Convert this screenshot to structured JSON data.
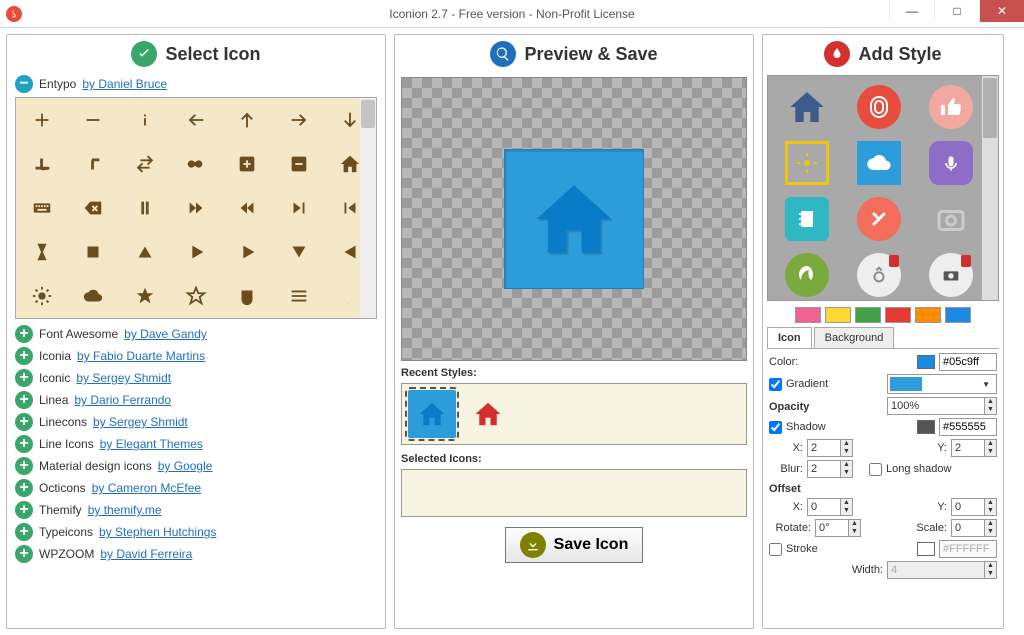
{
  "window": {
    "title": "Iconion 2.7 - Free version - Non-Profit License"
  },
  "sections": {
    "select_icon": "Select Icon",
    "preview_save": "Preview & Save",
    "add_style": "Add Style"
  },
  "icon_sets": {
    "expanded": {
      "name": "Entypo",
      "by_prefix": "by",
      "author": "Daniel Bruce"
    },
    "collapsed": [
      {
        "name": "Font Awesome",
        "author": "Dave Gandy"
      },
      {
        "name": "Iconia",
        "author": "Fabio Duarte Martins"
      },
      {
        "name": "Iconic",
        "author": "Sergey Shmidt"
      },
      {
        "name": "Linea",
        "author": "Dario Ferrando"
      },
      {
        "name": "Linecons",
        "author": "Sergey Shmidt"
      },
      {
        "name": "Line Icons",
        "author": "Elegant Themes"
      },
      {
        "name": "Material design icons",
        "author": "Google"
      },
      {
        "name": "Octicons",
        "author": "Cameron McEfee"
      },
      {
        "name": "Themify",
        "author": "themify.me"
      },
      {
        "name": "Typeicons",
        "author": "Stephen Hutchings"
      },
      {
        "name": "WPZOOM",
        "author": "David Ferreira"
      }
    ]
  },
  "preview": {
    "recent_label": "Recent Styles:",
    "selected_label": "Selected Icons:",
    "save_button": "Save Icon"
  },
  "style_swatches": [
    "#f06292",
    "#fdd835",
    "#43a047",
    "#e53935",
    "#fb8c00",
    "#1e88e5"
  ],
  "tabs": {
    "icon": "Icon",
    "background": "Background"
  },
  "form": {
    "color_label": "Color:",
    "color_value": "#05c9ff",
    "color_swatch": "#1e88e5",
    "gradient_label": "Gradient",
    "gradient_checked": true,
    "gradient_dropdown_color": "#2d9cdb",
    "opacity_label": "Opacity",
    "opacity_value": "100%",
    "shadow_label": "Shadow",
    "shadow_checked": true,
    "shadow_color": "#555555",
    "shadow_swatch": "#555555",
    "x_label": "X:",
    "y_label": "Y:",
    "shadow_x": "2",
    "shadow_y": "2",
    "blur_label": "Blur:",
    "blur_value": "2",
    "longshadow_label": "Long shadow",
    "longshadow_checked": false,
    "offset_label": "Offset",
    "offset_x": "0",
    "offset_y": "0",
    "rotate_label": "Rotate:",
    "rotate_value": "0°",
    "scale_label": "Scale:",
    "scale_value": "0",
    "stroke_label": "Stroke",
    "stroke_checked": false,
    "stroke_color": "#FFFFFF",
    "width_label": "Width:",
    "width_value": "4"
  }
}
